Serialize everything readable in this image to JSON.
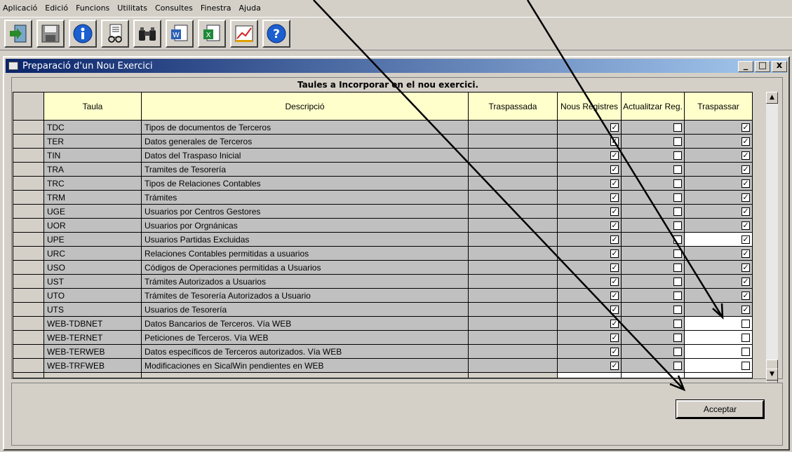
{
  "menu": [
    "Aplicació",
    "Edició",
    "Funcions",
    "Utilitats",
    "Consultes",
    "Finestra",
    "Ajuda"
  ],
  "toolbar": [
    "exit-icon",
    "save-icon",
    "info-icon",
    "print-preview-icon",
    "binoculars-icon",
    "word-icon",
    "excel-icon",
    "chart-icon",
    "help-icon"
  ],
  "window": {
    "title": "Preparació d'un Nou Exercici",
    "min": "_",
    "max": "□",
    "close": "x"
  },
  "grid": {
    "title": "Taules a Incorporar en el nou exercici.",
    "headers": {
      "taula": "Taula",
      "desc": "Descripció",
      "trasp": "Traspassada",
      "nous": "Nous Registres",
      "actual": "Actualitzar Reg.",
      "traspassar": "Traspassar"
    },
    "rows": [
      {
        "taula": "TDC",
        "desc": "Tipos de documentos de Terceros",
        "nous": true,
        "act": false,
        "tr": true
      },
      {
        "taula": "TER",
        "desc": "Datos generales de Terceros",
        "nous": true,
        "act": false,
        "tr": true
      },
      {
        "taula": "TIN",
        "desc": "Datos del Traspaso Inicial",
        "nous": true,
        "act": false,
        "tr": true
      },
      {
        "taula": "TRA",
        "desc": "Tramites de Tesorería",
        "nous": true,
        "act": false,
        "tr": true
      },
      {
        "taula": "TRC",
        "desc": "Tipos de Relaciones Contables",
        "nous": true,
        "act": false,
        "tr": true
      },
      {
        "taula": "TRM",
        "desc": "Trámites",
        "nous": true,
        "act": false,
        "tr": true
      },
      {
        "taula": "UGE",
        "desc": "Usuarios por Centros Gestores",
        "nous": true,
        "act": false,
        "tr": true
      },
      {
        "taula": "UOR",
        "desc": "Usuarios por Orgnánicas",
        "nous": true,
        "act": false,
        "tr": true
      },
      {
        "taula": "UPE",
        "desc": "Usuarios Partidas Excluidas",
        "nous": true,
        "act": false,
        "tr": true,
        "trWhite": true
      },
      {
        "taula": "URC",
        "desc": "Relaciones Contables permitidas a usuarios",
        "nous": true,
        "act": false,
        "tr": true
      },
      {
        "taula": "USO",
        "desc": "Códigos de Operaciones permitidas a Usuarios",
        "nous": true,
        "act": false,
        "tr": true
      },
      {
        "taula": "UST",
        "desc": "Trámites Autorizados a Usuarios",
        "nous": true,
        "act": false,
        "tr": true
      },
      {
        "taula": "UTO",
        "desc": "Trámites de Tesorería Autorizados a Usuario",
        "nous": true,
        "act": false,
        "tr": true
      },
      {
        "taula": "UTS",
        "desc": "Usuarios de Tesorería",
        "nous": true,
        "act": false,
        "tr": true
      },
      {
        "taula": "WEB-TDBNET",
        "desc": "Datos Bancarios de Terceros. Vía WEB",
        "nous": true,
        "act": false,
        "tr": false,
        "trWhite": true
      },
      {
        "taula": "WEB-TERNET",
        "desc": "Peticiones de Terceros. Vía WEB",
        "nous": true,
        "act": false,
        "tr": false,
        "trWhite": true
      },
      {
        "taula": "WEB-TERWEB",
        "desc": "Datos específicos de Terceros autorizados. Vía WEB",
        "nous": true,
        "act": false,
        "tr": false,
        "trWhite": true
      },
      {
        "taula": "WEB-TRFWEB",
        "desc": "Modificaciones en SicalWin pendientes en WEB",
        "nous": true,
        "act": false,
        "tr": false,
        "trWhite": true
      }
    ]
  },
  "accept": "Acceptar",
  "colors": {
    "titleStart": "#0a246a",
    "titleEnd": "#a6caf0",
    "header": "#ffffcc",
    "row": "#c0c0c0",
    "face": "#d4d0c8"
  }
}
